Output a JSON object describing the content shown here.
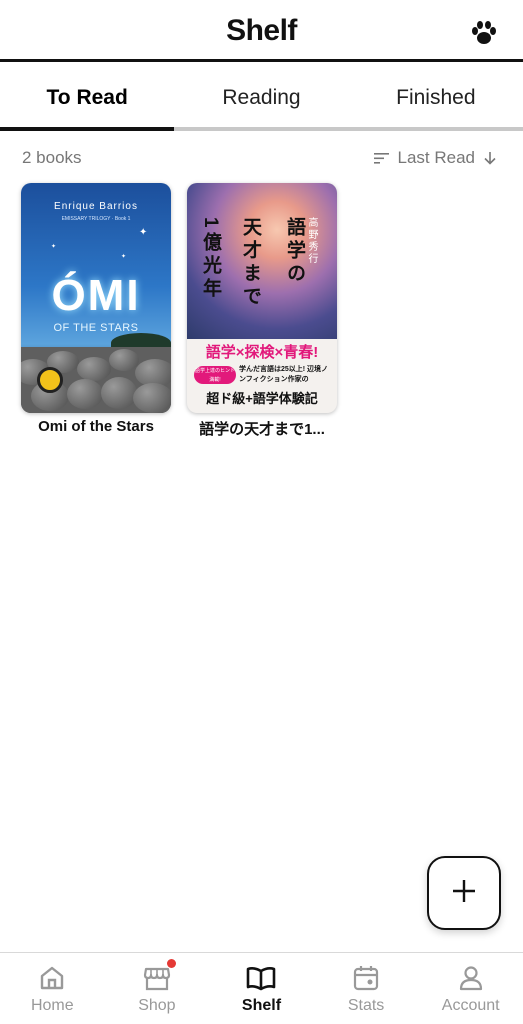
{
  "header": {
    "title": "Shelf",
    "paw_icon": "paw-icon"
  },
  "tabs": [
    {
      "label": "To Read",
      "active": true
    },
    {
      "label": "Reading",
      "active": false
    },
    {
      "label": "Finished",
      "active": false
    }
  ],
  "toolbar": {
    "count": "2 books",
    "sort_label": "Last Read",
    "sort_icon": "sort-lines-icon",
    "sort_direction_icon": "arrow-down-icon"
  },
  "books": [
    {
      "title": "Omi of the Stars",
      "cover": {
        "author": "Enrique Barrios",
        "series": "EMISSARY TRILOGY · Book 1",
        "big_title": "ÓMI",
        "subtitle": "OF THE STARS"
      }
    },
    {
      "title": "語学の天才まで1...",
      "cover": {
        "col1": "語学の",
        "col2": "天才まで",
        "col3": "1億光年",
        "author": "高野秀行",
        "band1": "語学×探検×青春!",
        "pill": "語学上達のヒント満載!",
        "small": "学んだ言語は25以上! 辺境ノンフィクション作家の",
        "band2": "超ド級+語学体験記"
      }
    }
  ],
  "fab": {
    "label": "+",
    "icon": "plus-icon"
  },
  "bottom_nav": [
    {
      "label": "Home",
      "icon": "home-icon",
      "active": false
    },
    {
      "label": "Shop",
      "icon": "shop-icon",
      "active": false,
      "badge": true
    },
    {
      "label": "Shelf",
      "icon": "book-open-icon",
      "active": true
    },
    {
      "label": "Stats",
      "icon": "calendar-icon",
      "active": false
    },
    {
      "label": "Account",
      "icon": "user-icon",
      "active": false
    }
  ],
  "colors": {
    "accent": "#111111",
    "badge": "#e53935",
    "muted": "#999999"
  }
}
